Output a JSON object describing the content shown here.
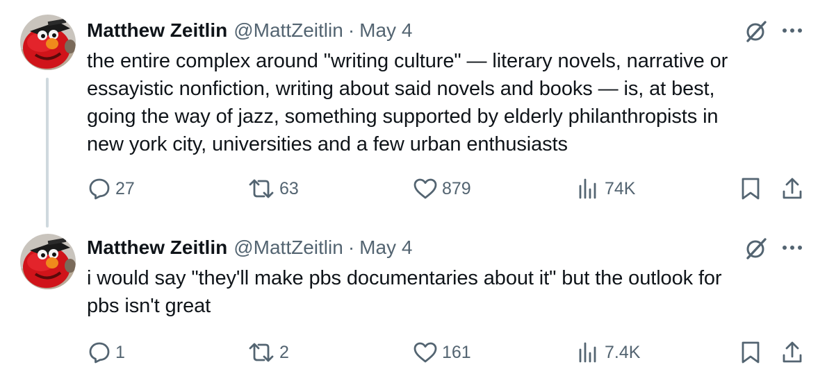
{
  "tweets": [
    {
      "name": "Matthew Zeitlin",
      "handle": "@MattZeitlin",
      "separator": "·",
      "date": "May 4",
      "text": "the entire complex around \"writing culture\" — literary novels, narrative or\nessayistic nonfiction, writing about said novels and books — is, at best,\ngoing the way of jazz, something supported by elderly philanthropists in\nnew york city, universities and a few urban enthusiasts",
      "replies": "27",
      "reposts": "63",
      "likes": "879",
      "views": "74K"
    },
    {
      "name": "Matthew Zeitlin",
      "handle": "@MattZeitlin",
      "separator": "·",
      "date": "May 4",
      "text": "i would say \"they'll make pbs documentaries about it\" but the outlook for\npbs isn't great",
      "replies": "1",
      "reposts": "2",
      "likes": "161",
      "views": "7.4K"
    }
  ],
  "icons": {
    "avatar": "elmo-avatar",
    "grok": "grok-icon",
    "more": "more-icon",
    "reply": "reply-icon",
    "repost": "repost-icon",
    "like": "heart-icon",
    "views": "views-icon",
    "bookmark": "bookmark-icon",
    "share": "share-icon"
  },
  "colors": {
    "text": "#0f1419",
    "secondary": "#536471",
    "thread_line": "#cfd9de",
    "background": "#ffffff"
  }
}
